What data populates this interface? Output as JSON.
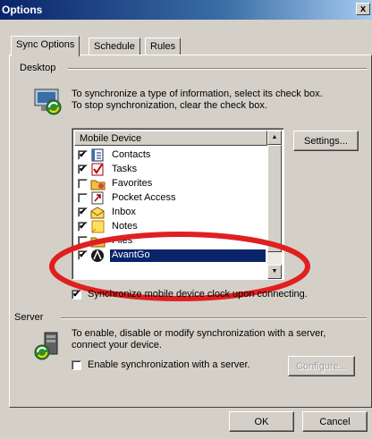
{
  "window": {
    "title": "Options",
    "close_glyph": "x"
  },
  "tabs": [
    {
      "label": "Sync Options",
      "active": true
    },
    {
      "label": "Schedule",
      "active": false
    },
    {
      "label": "Rules",
      "active": false
    }
  ],
  "desktop": {
    "label": "Desktop",
    "description_line1": "To synchronize a type of information, select its check box.",
    "description_line2": "To stop synchronization, clear the check box.",
    "list_header": "Mobile Device",
    "settings_button": "Settings...",
    "items": [
      {
        "label": "Contacts",
        "checked": true,
        "icon": "contacts-icon"
      },
      {
        "label": "Tasks",
        "checked": true,
        "icon": "tasks-icon"
      },
      {
        "label": "Favorites",
        "checked": false,
        "icon": "favorites-icon"
      },
      {
        "label": "Pocket Access",
        "checked": false,
        "icon": "pocket-access-icon"
      },
      {
        "label": "Inbox",
        "checked": true,
        "icon": "inbox-icon"
      },
      {
        "label": "Notes",
        "checked": true,
        "icon": "notes-icon"
      },
      {
        "label": "Files",
        "checked": false,
        "icon": "files-icon"
      },
      {
        "label": "AvantGo",
        "checked": true,
        "icon": "avantgo-icon",
        "selected": true
      }
    ],
    "clock_checkbox": {
      "label": "Synchronize mobile device clock upon connecting.",
      "checked": true
    }
  },
  "server": {
    "label": "Server",
    "description_line1": "To enable, disable or modify synchronization with a server,",
    "description_line2": "connect your device.",
    "enable_checkbox": {
      "label": "Enable synchronization with a server.",
      "checked": false
    },
    "configure_button": "Configure..."
  },
  "footer": {
    "ok_button": "OK",
    "cancel_button": "Cancel"
  },
  "annotation_color": "#e02020"
}
